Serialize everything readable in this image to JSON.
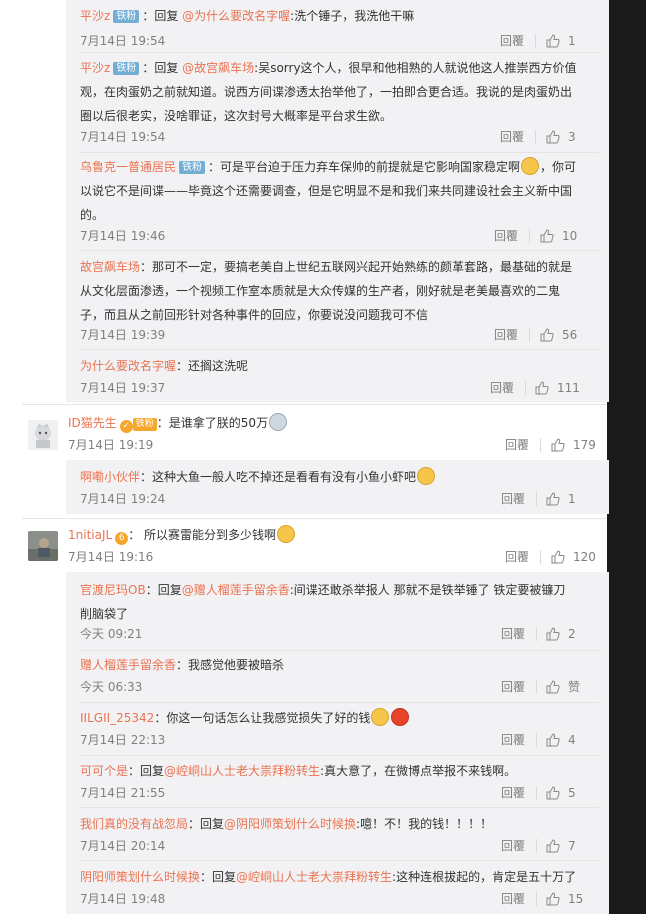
{
  "page": {
    "reply_label": "回覆",
    "badge_fan": "铁粉"
  },
  "replies_a": [
    {
      "user": "平沙z",
      "prefix": "：回复 ",
      "at": "@为什么要改名字喔",
      "text": ":洗个锤子，我洗他干嘛",
      "time": "7月14日 19:54",
      "likes": "1"
    },
    {
      "user": "平沙z",
      "prefix": "：回复 ",
      "at": "@故宫飙车场",
      "line1": ":吴sorry这个人，很早和他相熟的人就说他这人推崇西方价值",
      "line2": "观，在肉蛋奶之前就知道。说西方间谍渗透太抬举他了，一拍即合更合适。我说的是肉蛋奶出",
      "line3": "圈以后很老实，没啥罪证，这次封号大概率是平台求生欲。",
      "time": "7月14日 19:54",
      "likes": "3"
    },
    {
      "user": "乌鲁克一普通居民",
      "line1": "：可是平台迫于压力弃车保帅的前提就是它影响国家稳定啊",
      "line1b": "，你可",
      "line2": "以说它不是间谍——毕竟这个还需要调查，但是它明显不是和我们来共同建设社会主义新中国",
      "line3": "的。",
      "time": "7月14日 19:46",
      "likes": "10"
    },
    {
      "user": "故宫飙车场",
      "line1": "：那可不一定，要搞老美自上世纪五联网兴起开始熟练的颜革套路，最基础的就是",
      "line2": "从文化层面渗透，一个视频工作室本质就是大众传媒的生产者，刚好就是老美最喜欢的二鬼",
      "line3": "子，而且从之前回形针对各种事件的回应，你要说没问题我可不信",
      "time": "7月14日 19:39",
      "likes": "56"
    },
    {
      "user": "为什么要改名字喔",
      "text": "：还搁这洗呢",
      "time": "7月14日 19:37",
      "likes": "111"
    }
  ],
  "comment_b": {
    "user": "ID猫先生",
    "text": "：是谁拿了朕的50万",
    "time": "7月14日 19:19",
    "likes": "179",
    "vip": "铁粉"
  },
  "reply_b": {
    "user": "啊嘞小伙伴",
    "text": "：这种大鱼一般人吃不掉还是看看有没有小鱼小虾吧",
    "time": "7月14日 19:24",
    "likes": "1"
  },
  "comment_c": {
    "user": "1nitiaJL",
    "text": "： 所以赛雷能分到多少钱啊",
    "time": "7月14日 19:16",
    "likes": "120",
    "vip": "6"
  },
  "replies_c": [
    {
      "user": "官渡尼玛OB",
      "prefix": "：回复",
      "at": "@赠人榴莲手留余香",
      "line1": ":间谍还敢杀举报人  那就不是铁举锤了  铁定要被镰刀",
      "line2": "削脑袋了",
      "time": "今天 09:21",
      "likes": "2"
    },
    {
      "user": "赠人榴莲手留余香",
      "text": "：我感觉他要被暗杀",
      "time": "今天 06:33",
      "likes": "赞"
    },
    {
      "user": "IILGII_25342",
      "text": "：你这一句话怎么让我感觉损失了好的钱",
      "time": "7月14日 22:13",
      "likes": "4"
    },
    {
      "user": "可可个是",
      "prefix": "：回复",
      "at": "@崆峒山人士老大祟拜粉转生",
      "text": ":真大意了，在微博点举报不来钱啊。",
      "time": "7月14日 21:55",
      "likes": "5"
    },
    {
      "user": "我们真的没有战忽局",
      "prefix": "：回复",
      "at": "@阴阳师策划什么时候换",
      "text": ":噫！不！我的钱！！！！",
      "time": "7月14日 20:14",
      "likes": "7"
    },
    {
      "user": "阴阳师策划什么时候换",
      "prefix": "：回复",
      "at": "@崆峒山人士老大祟拜粉转生",
      "text": ":这种连根拔起的，肯定是五十万了",
      "time": "7月14日 19:48",
      "likes": "15"
    }
  ]
}
